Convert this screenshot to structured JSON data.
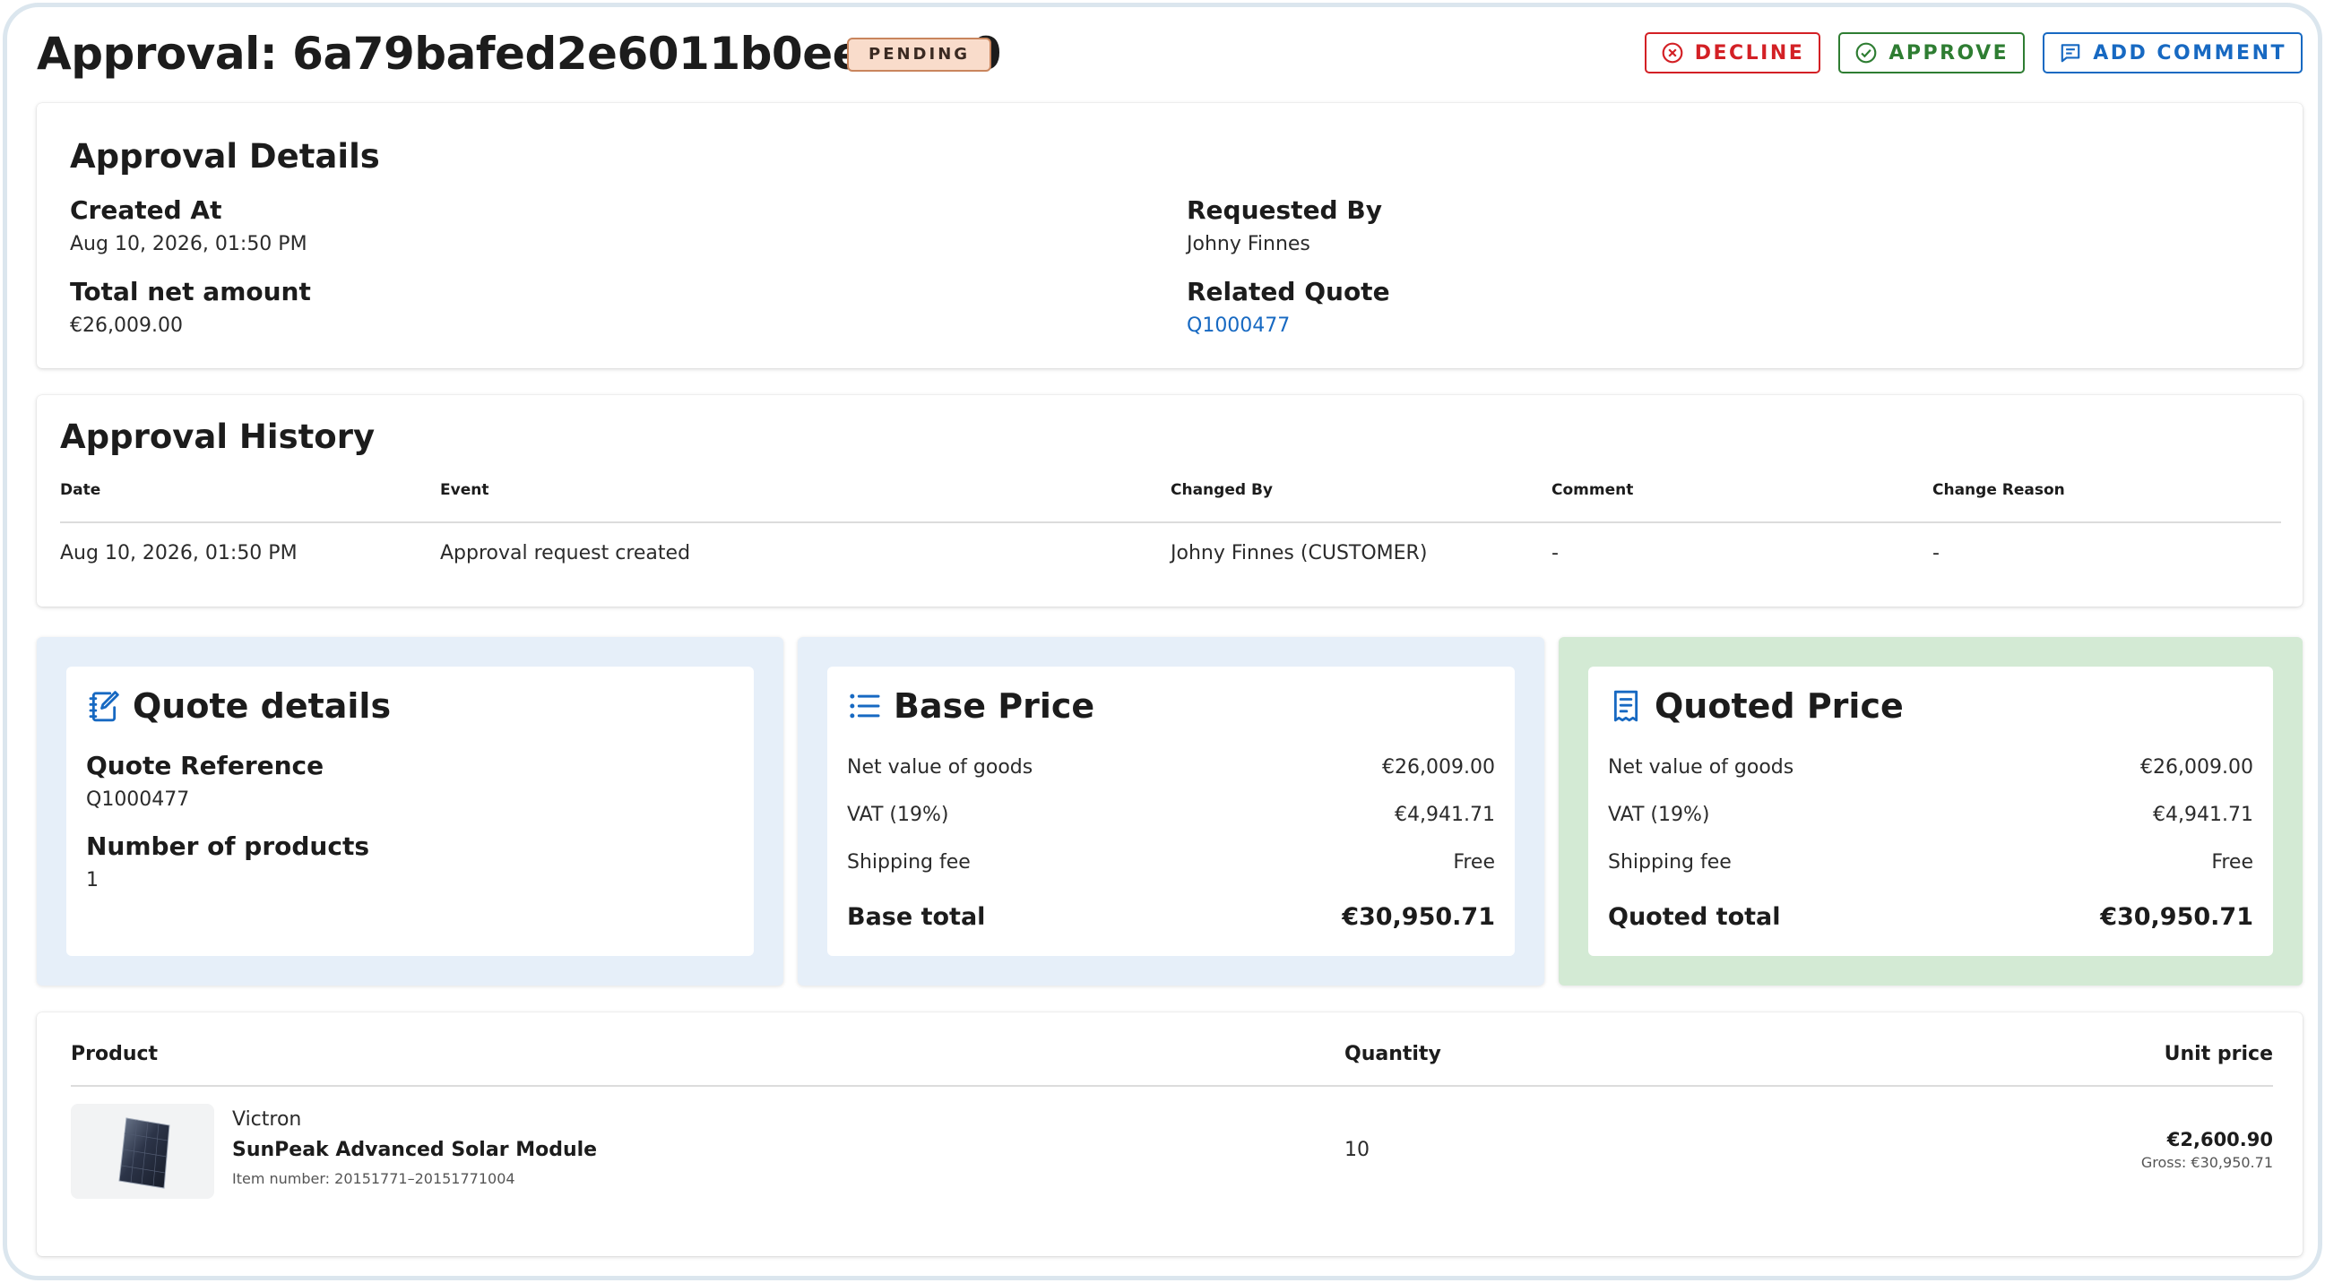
{
  "header": {
    "title": "Approval: 6a79bafed2e6011b0eeccca0",
    "status": "PENDING",
    "actions": {
      "decline": "DECLINE",
      "approve": "APPROVE",
      "comment": "ADD COMMENT"
    }
  },
  "details": {
    "title": "Approval Details",
    "created_at_label": "Created At",
    "created_at": "Aug 10, 2026, 01:50 PM",
    "total_net_label": "Total net amount",
    "total_net": "€26,009.00",
    "requested_by_label": "Requested By",
    "requested_by": "Johny Finnes",
    "related_quote_label": "Related Quote",
    "related_quote": "Q1000477"
  },
  "history": {
    "title": "Approval History",
    "columns": [
      "Date",
      "Event",
      "Changed By",
      "Comment",
      "Change Reason"
    ],
    "rows": [
      [
        "Aug 10, 2026, 01:50 PM",
        "Approval request created",
        "Johny Finnes (CUSTOMER)",
        "-",
        "-"
      ]
    ]
  },
  "quote_details": {
    "title": "Quote details",
    "reference_label": "Quote Reference",
    "reference": "Q1000477",
    "products_label": "Number of products",
    "products": "1"
  },
  "base_price": {
    "title": "Base Price",
    "rows": [
      {
        "label": "Net value of goods",
        "value": "€26,009.00"
      },
      {
        "label": "VAT (19%)",
        "value": "€4,941.71"
      },
      {
        "label": "Shipping fee",
        "value": "Free"
      }
    ],
    "total_label": "Base total",
    "total": "€30,950.71"
  },
  "quoted_price": {
    "title": "Quoted Price",
    "rows": [
      {
        "label": "Net value of goods",
        "value": "€26,009.00"
      },
      {
        "label": "VAT (19%)",
        "value": "€4,941.71"
      },
      {
        "label": "Shipping fee",
        "value": "Free"
      }
    ],
    "total_label": "Quoted total",
    "total": "€30,950.71"
  },
  "products": {
    "columns": {
      "product": "Product",
      "quantity": "Quantity",
      "unit_price": "Unit price"
    },
    "items": [
      {
        "brand": "Victron",
        "name": "SunPeak Advanced Solar Module",
        "item_number": "Item number: 20151771–20151771004",
        "quantity": "10",
        "unit_price": "€2,600.90",
        "gross": "Gross: €30,950.71"
      }
    ]
  },
  "colors": {
    "decline": "#d32025",
    "approve": "#2e7d32",
    "accent": "#1769c2",
    "badge_bg": "#f9dccb",
    "panel_blue": "#e6eff9",
    "panel_green": "#d3ead4"
  },
  "icons": {
    "decline": "close-circle-icon",
    "approve": "check-circle-icon",
    "comment": "comment-icon",
    "quote_details": "edit-notebook-icon",
    "base_price": "list-icon",
    "quoted_price": "receipt-icon"
  }
}
